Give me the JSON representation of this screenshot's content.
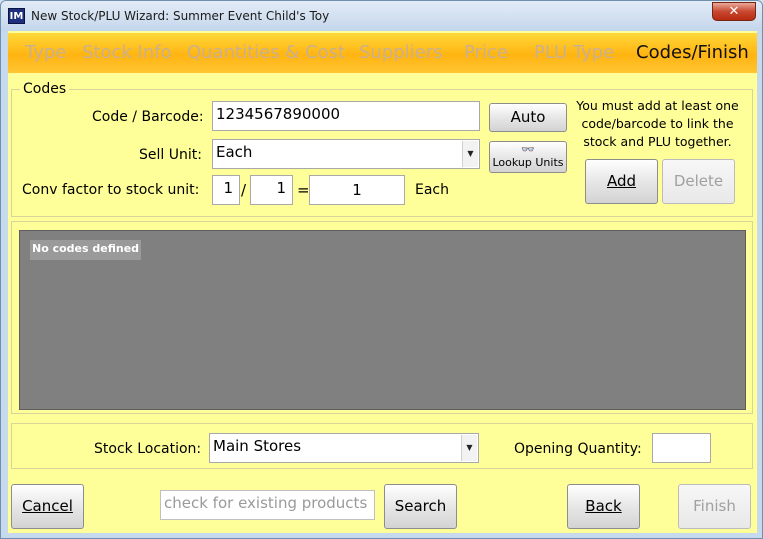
{
  "window": {
    "title": "New Stock/PLU Wizard: Summer Event Child's Toy",
    "icon_label": "IM",
    "close_glyph": "✕"
  },
  "tabs": [
    {
      "label": "Type",
      "active": false
    },
    {
      "label": "Stock Info",
      "active": false
    },
    {
      "label": "Quantities & Cost",
      "active": false
    },
    {
      "label": "Suppliers",
      "active": false
    },
    {
      "label": "Price",
      "active": false
    },
    {
      "label": "PLU Type",
      "active": false
    },
    {
      "label": "Codes/Finish",
      "active": true
    }
  ],
  "codes": {
    "legend": "Codes",
    "code_label": "Code / Barcode:",
    "code_value": "1234567890000",
    "auto_button": "Auto",
    "sell_unit_label": "Sell Unit:",
    "sell_unit_value": "Each",
    "lookup_button": "Lookup Units",
    "conv_label": "Conv factor to stock unit:",
    "conv_num1": "1",
    "conv_slash": "/",
    "conv_num2": "1",
    "conv_equals": "=",
    "conv_result": "1",
    "conv_unit": "Each",
    "info_text": "You must add at least one code/barcode to link the stock and PLU together.",
    "add_button": "Add",
    "delete_button": "Delete"
  },
  "list": {
    "empty_text": "No codes defined"
  },
  "location": {
    "stock_location_label": "Stock Location:",
    "stock_location_value": "Main Stores",
    "opening_qty_label": "Opening Quantity:",
    "opening_qty_value": ""
  },
  "footer": {
    "cancel_button": "Cancel",
    "search_placeholder": "check for existing products",
    "search_button": "Search",
    "back_button": "Back",
    "finish_button": "Finish"
  },
  "colors": {
    "panel_bg": "#ffff99",
    "tab_bar": "#ffb411",
    "list_bg": "#808080"
  }
}
